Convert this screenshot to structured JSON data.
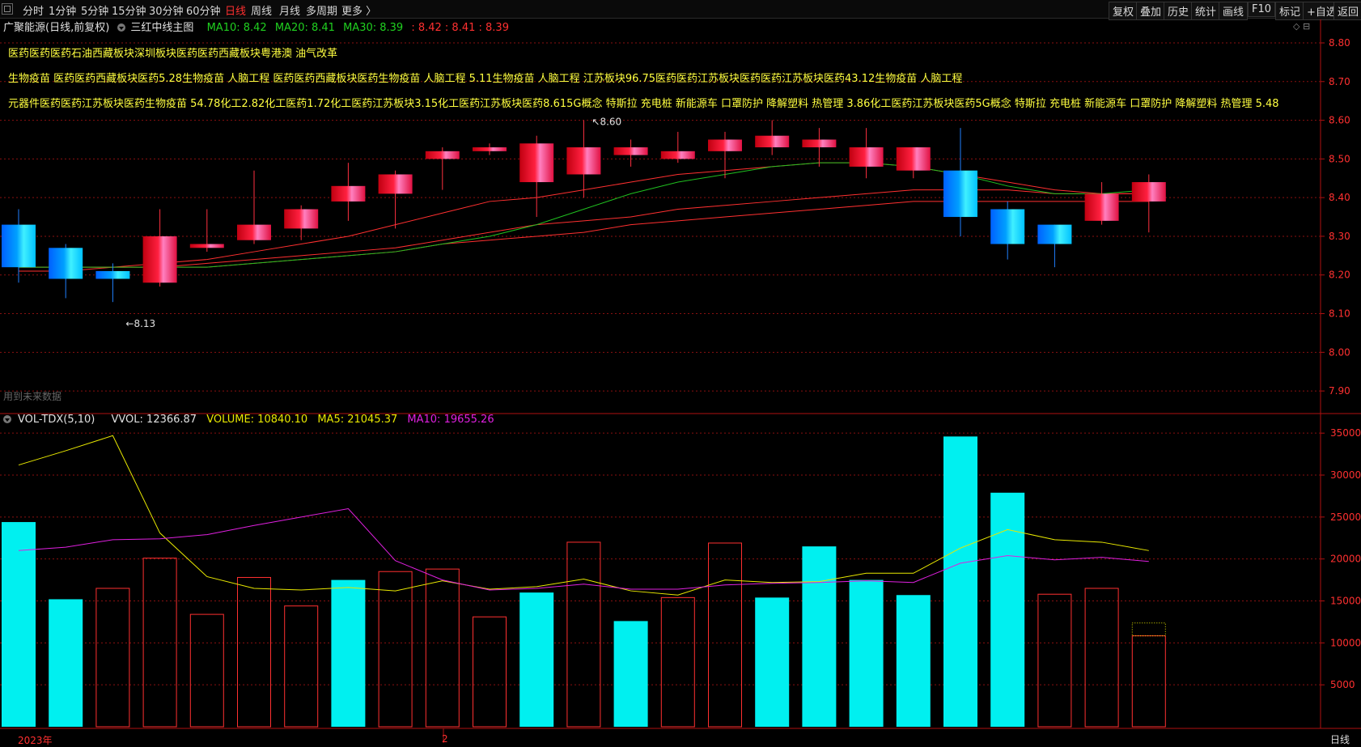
{
  "toolbar": {
    "periods": [
      "分时",
      "1分钟",
      "5分钟",
      "15分钟",
      "30分钟",
      "60分钟",
      "日线",
      "周线",
      "月线",
      "多周期",
      "更多 〉"
    ],
    "active_period": "日线",
    "right_buttons": [
      "复权",
      "叠加",
      "历史",
      "统计",
      "画线",
      "F10",
      "标记",
      "+自选",
      "返回"
    ]
  },
  "info": {
    "stock": "广聚能源(日线,前复权)",
    "indicator": "三红中线主图",
    "ma10": "MA10: 8.42",
    "ma20": "MA20: 8.41",
    "ma30": "MA30: 8.39",
    "extra": ": 8.42 : 8.41 : 8.39"
  },
  "concepts": [
    "医药医药医药石油西藏板块深圳板块医药医药西藏板块粤港澳 油气改革",
    "生物疫苗 医药医药西藏板块医药5.28生物疫苗 人脑工程 医药医药西藏板块医药生物疫苗 人脑工程 5.11生物疫苗 人脑工程 江苏板块96.75医药医药江苏板块医药医药江苏板块医药43.12生物疫苗 人脑工程",
    "元器件医药医药江苏板块医药生物疫苗 54.78化工2.82化工医药1.72化工医药江苏板块3.15化工医药江苏板块医药8.615G概念 特斯拉 充电桩 新能源车 口罩防护 降解塑料 热管理 3.86化工医药江苏板块医药5G概念 特斯拉 充电桩 新能源车 口罩防护 降解塑料 热管理 5.48"
  ],
  "note": "用到未来数据",
  "volume_info": {
    "name": "VOL-TDX(5,10)",
    "vvol": "VVOL: 12366.87",
    "volume": "VOLUME: 10840.10",
    "ma5": "MA5: 21045.37",
    "ma10": "MA10: 19655.26"
  },
  "footer": {
    "year": "2023年",
    "month": "2",
    "period": "日线"
  },
  "colors": {
    "up": "#ff3040",
    "down": "#00e5ff",
    "ma_red": "#ff3030",
    "ma_green": "#20c020",
    "vol_ma5": "#e8e800",
    "vol_ma10": "#e020e0"
  },
  "chart_data": [
    {
      "type": "candlestick",
      "price_axis": [
        8.8,
        8.7,
        8.6,
        8.5,
        8.4,
        8.3,
        8.2,
        8.1,
        8.0,
        7.9
      ],
      "ylim": [
        7.85,
        8.8
      ],
      "labels": {
        "low": "8.13",
        "high": "8.60"
      },
      "candles": [
        {
          "o": 8.33,
          "c": 8.22,
          "h": 8.37,
          "l": 8.18
        },
        {
          "o": 8.27,
          "c": 8.19,
          "h": 8.28,
          "l": 8.14
        },
        {
          "o": 8.21,
          "c": 8.19,
          "h": 8.23,
          "l": 8.13
        },
        {
          "o": 8.18,
          "c": 8.3,
          "h": 8.37,
          "l": 8.17
        },
        {
          "o": 8.27,
          "c": 8.28,
          "h": 8.37,
          "l": 8.26
        },
        {
          "o": 8.29,
          "c": 8.33,
          "h": 8.47,
          "l": 8.28
        },
        {
          "o": 8.32,
          "c": 8.37,
          "h": 8.38,
          "l": 8.29
        },
        {
          "o": 8.39,
          "c": 8.43,
          "h": 8.49,
          "l": 8.34
        },
        {
          "o": 8.41,
          "c": 8.46,
          "h": 8.47,
          "l": 8.32
        },
        {
          "o": 8.5,
          "c": 8.52,
          "h": 8.53,
          "l": 8.42
        },
        {
          "o": 8.52,
          "c": 8.53,
          "h": 8.54,
          "l": 8.51
        },
        {
          "o": 8.44,
          "c": 8.54,
          "h": 8.56,
          "l": 8.35
        },
        {
          "o": 8.46,
          "c": 8.53,
          "h": 8.6,
          "l": 8.4
        },
        {
          "o": 8.51,
          "c": 8.53,
          "h": 8.55,
          "l": 8.48
        },
        {
          "o": 8.5,
          "c": 8.52,
          "h": 8.57,
          "l": 8.49
        },
        {
          "o": 8.52,
          "c": 8.55,
          "h": 8.57,
          "l": 8.45
        },
        {
          "o": 8.53,
          "c": 8.56,
          "h": 8.6,
          "l": 8.51
        },
        {
          "o": 8.53,
          "c": 8.55,
          "h": 8.58,
          "l": 8.48
        },
        {
          "o": 8.48,
          "c": 8.53,
          "h": 8.58,
          "l": 8.45
        },
        {
          "o": 8.47,
          "c": 8.53,
          "h": 8.53,
          "l": 8.45
        },
        {
          "o": 8.47,
          "c": 8.35,
          "h": 8.58,
          "l": 8.3
        },
        {
          "o": 8.37,
          "c": 8.28,
          "h": 8.39,
          "l": 8.24
        },
        {
          "o": 8.33,
          "c": 8.28,
          "h": 8.33,
          "l": 8.22
        },
        {
          "o": 8.34,
          "c": 8.41,
          "h": 8.44,
          "l": 8.33
        },
        {
          "o": 8.39,
          "c": 8.44,
          "h": 8.46,
          "l": 8.31
        }
      ],
      "ma_lines": [
        {
          "name": "MA10",
          "color": "#ff3030",
          "values": [
            8.21,
            8.21,
            8.22,
            8.23,
            8.24,
            8.26,
            8.28,
            8.3,
            8.33,
            8.36,
            8.39,
            8.4,
            8.42,
            8.44,
            8.46,
            8.47,
            8.48,
            8.49,
            8.49,
            8.48,
            8.46,
            8.44,
            8.42,
            8.41,
            8.41
          ]
        },
        {
          "name": "MA20",
          "color": "#ff3030",
          "values": [
            8.22,
            8.22,
            8.22,
            8.22,
            8.23,
            8.24,
            8.25,
            8.26,
            8.27,
            8.29,
            8.31,
            8.33,
            8.34,
            8.35,
            8.37,
            8.38,
            8.39,
            8.4,
            8.41,
            8.42,
            8.42,
            8.42,
            8.41,
            8.41,
            8.41
          ]
        },
        {
          "name": "MA30",
          "color": "#ff3030",
          "values": [
            8.22,
            8.22,
            8.22,
            8.22,
            8.22,
            8.23,
            8.24,
            8.25,
            8.26,
            8.28,
            8.29,
            8.3,
            8.31,
            8.33,
            8.34,
            8.35,
            8.36,
            8.37,
            8.38,
            8.39,
            8.39,
            8.39,
            8.39,
            8.39,
            8.39
          ]
        },
        {
          "name": "Green",
          "color": "#20c020",
          "values": [
            8.22,
            8.22,
            8.22,
            8.22,
            8.22,
            8.23,
            8.24,
            8.25,
            8.26,
            8.28,
            8.3,
            8.33,
            8.37,
            8.41,
            8.44,
            8.46,
            8.48,
            8.49,
            8.49,
            8.48,
            8.46,
            8.43,
            8.41,
            8.41,
            8.42
          ]
        }
      ]
    },
    {
      "type": "bar",
      "title": "VOL-TDX(5,10)",
      "volume_axis": [
        35000,
        30000,
        25000,
        20000,
        15000,
        10000,
        5000
      ],
      "ylim": [
        0,
        35500
      ],
      "volumes": [
        24400,
        15200,
        16500,
        20100,
        13400,
        17800,
        14400,
        17500,
        18500,
        18800,
        13100,
        16000,
        22000,
        12600,
        15400,
        21900,
        15400,
        21500,
        17500,
        15700,
        34600,
        27900,
        15800,
        16500,
        10840
      ],
      "directions": [
        "down",
        "down",
        "up",
        "up",
        "up",
        "up",
        "up",
        "down",
        "up",
        "up",
        "up",
        "down",
        "up",
        "down",
        "up",
        "up",
        "down",
        "down",
        "down",
        "down",
        "down",
        "down",
        "up",
        "up",
        "up"
      ],
      "vvol_last": 12366.87,
      "ma5": [
        31200,
        32900,
        34700,
        23100,
        17900,
        16500,
        16300,
        16600,
        16200,
        17400,
        16400,
        16700,
        17600,
        16200,
        15700,
        17500,
        17200,
        17300,
        18300,
        18300,
        21300,
        23500,
        22300,
        22000,
        21000
      ],
      "ma10": [
        21000,
        21400,
        22300,
        22400,
        22900,
        24000,
        25000,
        26000,
        19800,
        17500,
        16300,
        16500,
        17000,
        16400,
        16400,
        16900,
        17100,
        17200,
        17400,
        17200,
        19500,
        20400,
        19900,
        20200,
        19700
      ]
    }
  ]
}
